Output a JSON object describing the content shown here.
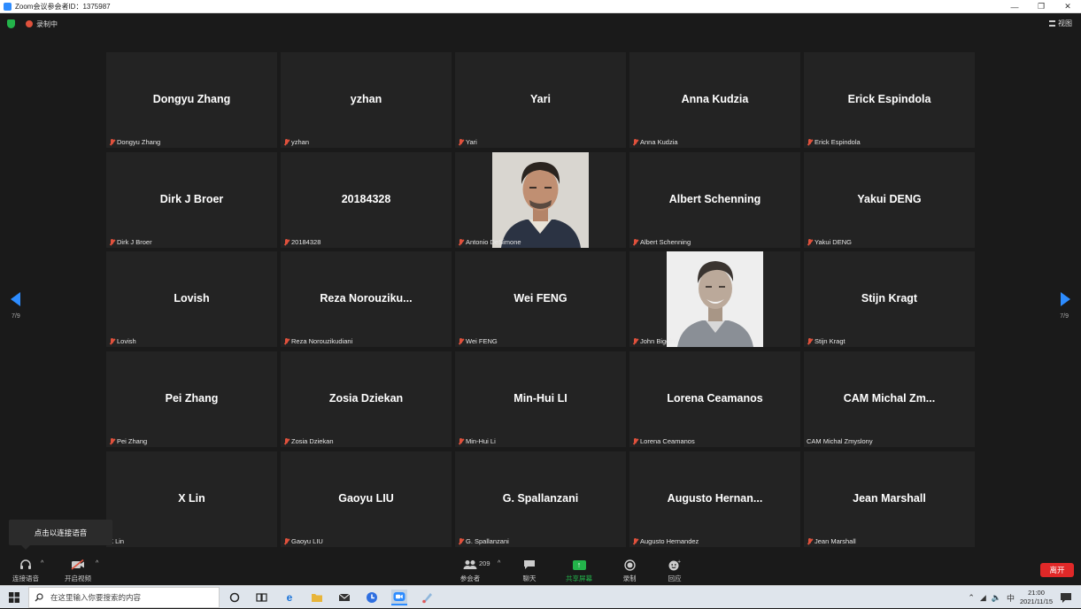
{
  "window": {
    "title": "Zoom会议参会者ID：1375987",
    "min": "—",
    "restore": "❐",
    "close": "✕"
  },
  "topbar": {
    "recording_label": "录制中",
    "view_label": "视图"
  },
  "tiles": [
    {
      "name": "Dongyu Zhang",
      "footer": "Dongyu Zhang",
      "muted": true
    },
    {
      "name": "yzhan",
      "footer": "yzhan",
      "muted": true
    },
    {
      "name": "Yari",
      "footer": "Yari",
      "muted": true
    },
    {
      "name": "Anna Kudzia",
      "footer": "Anna Kudzia",
      "muted": true
    },
    {
      "name": "Erick Espindola",
      "footer": "Erick Espindola",
      "muted": true
    },
    {
      "name": "Dirk J Broer",
      "footer": "Dirk J Broer",
      "muted": true
    },
    {
      "name": "20184328",
      "footer": "20184328",
      "muted": true
    },
    {
      "name": "",
      "footer": "Antonio DeSimone",
      "muted": true,
      "photo": "portrait-antonio"
    },
    {
      "name": "Albert Schenning",
      "footer": "Albert Schenning",
      "muted": true
    },
    {
      "name": "Yakui DENG",
      "footer": "Yakui DENG",
      "muted": true
    },
    {
      "name": "Lovish",
      "footer": "Lovish",
      "muted": true
    },
    {
      "name": "Reza  Norouziku...",
      "footer": "Reza Norouzikudiani",
      "muted": true
    },
    {
      "name": "Wei FENG",
      "footer": "Wei FENG",
      "muted": true
    },
    {
      "name": "",
      "footer": "John Biggins",
      "muted": true,
      "photo": "portrait-john"
    },
    {
      "name": "Stijn Kragt",
      "footer": "Stijn Kragt",
      "muted": true
    },
    {
      "name": "Pei Zhang",
      "footer": "Pei Zhang",
      "muted": true
    },
    {
      "name": "Zosia Dziekan",
      "footer": "Zosia Dziekan",
      "muted": true
    },
    {
      "name": "Min-Hui LI",
      "footer": "Min-Hui Li",
      "muted": true
    },
    {
      "name": "Lorena Ceamanos",
      "footer": "Lorena Ceamanos",
      "muted": true
    },
    {
      "name": "CAM  Michal  Zm...",
      "footer": "CAM Michal Zmyslony",
      "muted": false
    },
    {
      "name": "X Lin",
      "footer": "X Lin",
      "muted": false
    },
    {
      "name": "Gaoyu LIU",
      "footer": "Gaoyu LIU",
      "muted": true
    },
    {
      "name": "G. Spallanzani",
      "footer": "G. Spallanzani",
      "muted": true
    },
    {
      "name": "Augusto  Hernan...",
      "footer": "Augusto Hernandez",
      "muted": true
    },
    {
      "name": "Jean Marshall",
      "footer": "Jean Marshall",
      "muted": true
    }
  ],
  "pager": {
    "left": "7/9",
    "right": "7/9"
  },
  "tooltip": "点击以连接语音",
  "toolbar": {
    "audio": "连接语音",
    "video": "开启视频",
    "participants": "参会者",
    "participants_count": "209",
    "chat": "聊天",
    "share": "共享屏幕",
    "record": "录制",
    "reactions": "回应",
    "leave": "离开",
    "caret": "^"
  },
  "taskbar": {
    "search_placeholder": "在这里输入你要搜索的内容",
    "ime": "中",
    "time": "21:00",
    "date": "2021/11/15"
  },
  "colors": {
    "accent": "#2d8cff",
    "share": "#23b34a",
    "leave": "#e02828",
    "muted": "#e0513c"
  }
}
